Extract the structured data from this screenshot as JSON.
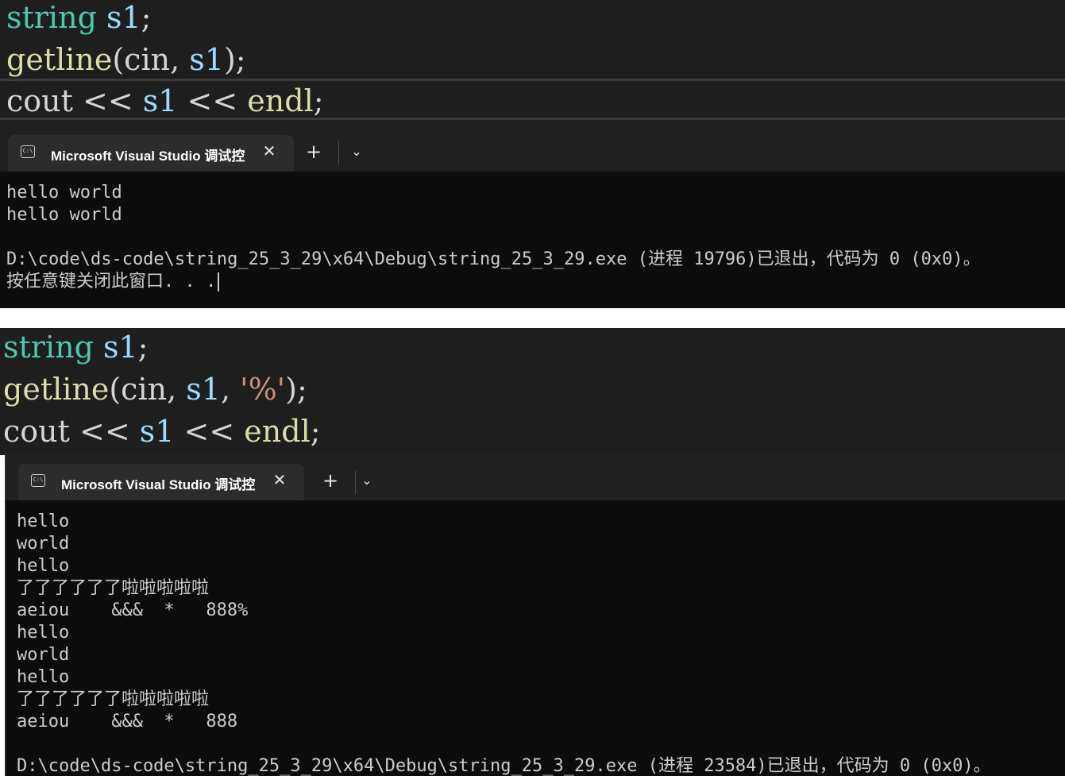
{
  "snippet1": {
    "lines": [
      [
        {
          "t": "string",
          "c": "type"
        },
        {
          "t": " ",
          "c": "plain"
        },
        {
          "t": "s1",
          "c": "var"
        },
        {
          "t": ";",
          "c": "plain"
        }
      ],
      [
        {
          "t": "getline",
          "c": "fn"
        },
        {
          "t": "(cin, ",
          "c": "plain"
        },
        {
          "t": "s1",
          "c": "var"
        },
        {
          "t": ");",
          "c": "plain"
        }
      ],
      [
        {
          "t": "cout",
          "c": "plain"
        },
        {
          "t": " << ",
          "c": "plain"
        },
        {
          "t": "s1",
          "c": "var"
        },
        {
          "t": " << ",
          "c": "plain"
        },
        {
          "t": "endl",
          "c": "fn"
        },
        {
          "t": ";",
          "c": "plain"
        }
      ]
    ]
  },
  "terminal1": {
    "tab_title": "Microsoft Visual Studio 调试控",
    "close_icon": "close-icon",
    "add_icon": "plus-icon",
    "dropdown_icon": "chevron-down-icon",
    "output": [
      "hello world",
      "hello world",
      "",
      "D:\\code\\ds-code\\string_25_3_29\\x64\\Debug\\string_25_3_29.exe (进程 19796)已退出，代码为 0 (0x0)。",
      "按任意键关闭此窗口. . ."
    ]
  },
  "snippet2": {
    "lines": [
      [
        {
          "t": "string",
          "c": "type"
        },
        {
          "t": " ",
          "c": "plain"
        },
        {
          "t": "s1",
          "c": "var"
        },
        {
          "t": ";",
          "c": "plain"
        }
      ],
      [
        {
          "t": "getline",
          "c": "fn"
        },
        {
          "t": "(cin, ",
          "c": "plain"
        },
        {
          "t": "s1",
          "c": "var"
        },
        {
          "t": ", ",
          "c": "plain"
        },
        {
          "t": "'%'",
          "c": "str"
        },
        {
          "t": ");",
          "c": "plain"
        }
      ],
      [
        {
          "t": "cout",
          "c": "plain"
        },
        {
          "t": " << ",
          "c": "plain"
        },
        {
          "t": "s1",
          "c": "var"
        },
        {
          "t": " << ",
          "c": "plain"
        },
        {
          "t": "endl",
          "c": "fn"
        },
        {
          "t": ";",
          "c": "plain"
        }
      ]
    ]
  },
  "terminal2": {
    "tab_title": "Microsoft Visual Studio 调试控",
    "close_icon": "close-icon",
    "add_icon": "plus-icon",
    "dropdown_icon": "chevron-down-icon",
    "output": [
      "hello",
      "world",
      "hello",
      "了了了了了了啦啦啦啦啦",
      "aeiou    &&&  *   888%",
      "hello",
      "world",
      "hello",
      "了了了了了了啦啦啦啦啦",
      "aeiou    &&&  *   888",
      "",
      "D:\\code\\ds-code\\string_25_3_29\\x64\\Debug\\string_25_3_29.exe (进程 23584)已退出，代码为 0 (0x0)。"
    ]
  }
}
